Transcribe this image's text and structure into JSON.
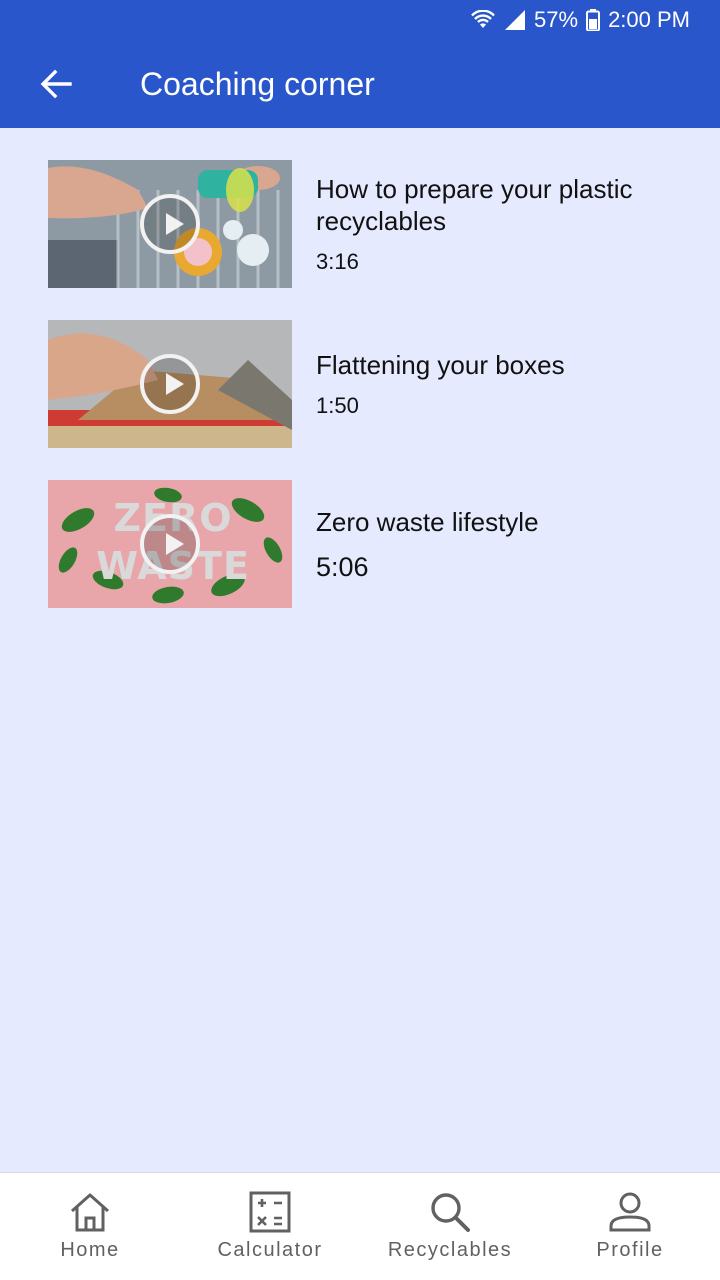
{
  "status": {
    "battery": "57%",
    "time": "2:00 PM",
    "icons": [
      "wifi-icon",
      "cell-signal-icon",
      "battery-icon"
    ]
  },
  "header": {
    "title": "Coaching corner",
    "back_icon": "arrow-back-icon"
  },
  "videos": [
    {
      "title": "How to prepare your plastic recyclables",
      "duration": "3:16"
    },
    {
      "title": "Flattening your boxes",
      "duration": "1:50"
    },
    {
      "title": "Zero waste lifestyle",
      "duration": "5:06",
      "thumb_text": "ZERO WASTE"
    }
  ],
  "nav": {
    "items": [
      {
        "label": "Home",
        "icon": "home-icon"
      },
      {
        "label": "Calculator",
        "icon": "calculator-icon"
      },
      {
        "label": "Recyclables",
        "icon": "search-icon"
      },
      {
        "label": "Profile",
        "icon": "person-icon"
      }
    ]
  },
  "colors": {
    "primary": "#2a56cc",
    "background": "#e6eafe",
    "nav_background": "#ffffff",
    "nav_text": "#616161"
  }
}
